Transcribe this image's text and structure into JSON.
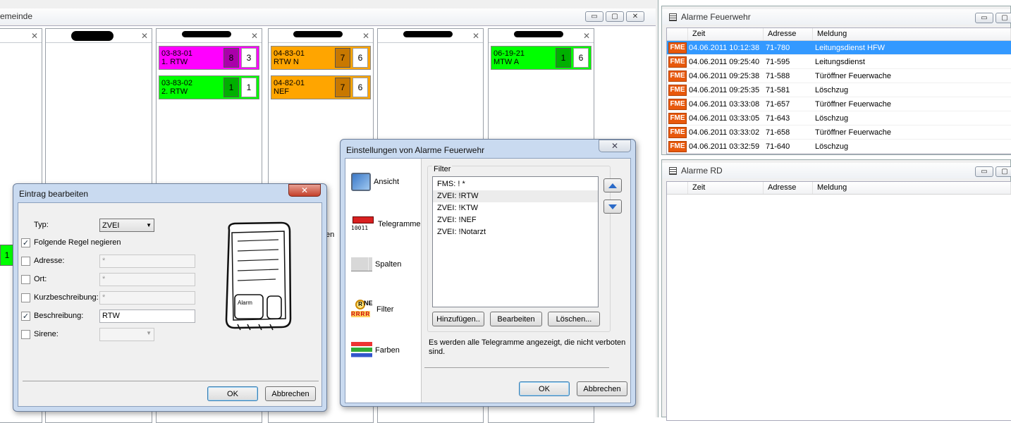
{
  "left_pane": {
    "title": "emeinde",
    "controls": {
      "minimize": "▭",
      "restore": "▢",
      "close": "✕"
    },
    "columns": [
      {
        "header": "",
        "cards": []
      },
      {
        "header": "",
        "cards": []
      },
      {
        "header": "",
        "cards": [
          {
            "line1": "03-83-01",
            "line2": "1. RTW",
            "status": "8",
            "count": "3",
            "color": "#ff00ff",
            "status_color": "#aa00aa"
          },
          {
            "line1": "03-83-02",
            "line2": "2. RTW",
            "status": "1",
            "count": "1",
            "color": "#00ff00",
            "status_color": "#00b000"
          }
        ]
      },
      {
        "header": "",
        "cards": [
          {
            "line1": "04-83-01",
            "line2": "RTW N",
            "status": "7",
            "count": "6",
            "color": "#ffa500",
            "status_color": "#c87800"
          },
          {
            "line1": "04-82-01",
            "line2": "NEF",
            "status": "7",
            "count": "6",
            "color": "#ffa500",
            "status_color": "#c87800"
          }
        ]
      },
      {
        "header": "",
        "cards": []
      },
      {
        "header": "",
        "cards": [
          {
            "line1": "06-19-21",
            "line2": "MTW A",
            "status": "1",
            "count": "6",
            "color": "#00ff00",
            "status_color": "#00b000"
          }
        ]
      }
    ],
    "bg_fragment": {
      "status": "1",
      "text": "en"
    }
  },
  "alarme_feuerwehr": {
    "title": "Alarme Feuerwehr",
    "columns": [
      "Zeit",
      "Adresse",
      "Meldung"
    ],
    "rows": [
      {
        "badge": "FME",
        "zeit": "04.06.2011 10:12:38",
        "adresse": "71-780",
        "meldung": "Leitungsdienst HFW",
        "selected": true
      },
      {
        "badge": "FME",
        "zeit": "04.06.2011 09:25:40",
        "adresse": "71-595",
        "meldung": "Leitungsdienst",
        "selected": false
      },
      {
        "badge": "FME",
        "zeit": "04.06.2011 09:25:38",
        "adresse": "71-588",
        "meldung": "Türöffner Feuerwache",
        "selected": false
      },
      {
        "badge": "FME",
        "zeit": "04.06.2011 09:25:35",
        "adresse": "71-581",
        "meldung": "Löschzug",
        "selected": false
      },
      {
        "badge": "FME",
        "zeit": "04.06.2011 03:33:08",
        "adresse": "71-657",
        "meldung": "Türöffner Feuerwache",
        "selected": false
      },
      {
        "badge": "FME",
        "zeit": "04.06.2011 03:33:05",
        "adresse": "71-643",
        "meldung": "Löschzug",
        "selected": false
      },
      {
        "badge": "FME",
        "zeit": "04.06.2011 03:33:02",
        "adresse": "71-658",
        "meldung": "Türöffner Feuerwache",
        "selected": false
      },
      {
        "badge": "FME",
        "zeit": "04.06.2011 03:32:59",
        "adresse": "71-640",
        "meldung": "Löschzug",
        "selected": false
      }
    ]
  },
  "alarme_rd": {
    "title": "Alarme RD",
    "columns": [
      "Zeit",
      "Adresse",
      "Meldung"
    ]
  },
  "edit_dialog": {
    "title": "Eintrag bearbeiten",
    "close": "✕",
    "typ_label": "Typ:",
    "typ_value": "ZVEI",
    "negate_label": "Folgende Regel negieren",
    "negate_checked": true,
    "fields": [
      {
        "label": "Adresse:",
        "value": "*",
        "checked": false
      },
      {
        "label": "Ort:",
        "value": "*",
        "checked": false
      },
      {
        "label": "Kurzbeschreibung:",
        "value": "*",
        "checked": false
      },
      {
        "label": "Beschreibung:",
        "value": "RTW",
        "checked": true
      },
      {
        "label": "Sirene:",
        "value": "",
        "checked": false
      }
    ],
    "pager_button": "Alarm",
    "ok": "OK",
    "cancel": "Abbrechen"
  },
  "settings_dialog": {
    "title": "Einstellungen von Alarme Feuerwehr",
    "close": "✕",
    "nav": [
      {
        "label": "Ansicht",
        "icon": "monitor-icon"
      },
      {
        "label": "Telegramme",
        "icon": "telegram-icon",
        "icon_text": "10011"
      },
      {
        "label": "Spalten",
        "icon": "columns-icon"
      },
      {
        "label": "Filter",
        "icon": "filter-icon",
        "icon_text": "NE",
        "icon_text2": "RRRR",
        "icon_text3": "R"
      },
      {
        "label": "Farben",
        "icon": "colors-icon"
      }
    ],
    "filter_group": "Filter",
    "filters": [
      "FMS: ! *",
      "ZVEI: !RTW",
      "ZVEI: !KTW",
      "ZVEI: !NEF",
      "ZVEI: !Notarzt"
    ],
    "selected_filter": 1,
    "add": "Hinzufügen..",
    "edit": "Bearbeiten",
    "delete": "Löschen...",
    "info": "Es werden alle Telegramme angezeigt, die nicht verboten sind.",
    "ok": "OK",
    "cancel": "Abbrechen"
  }
}
